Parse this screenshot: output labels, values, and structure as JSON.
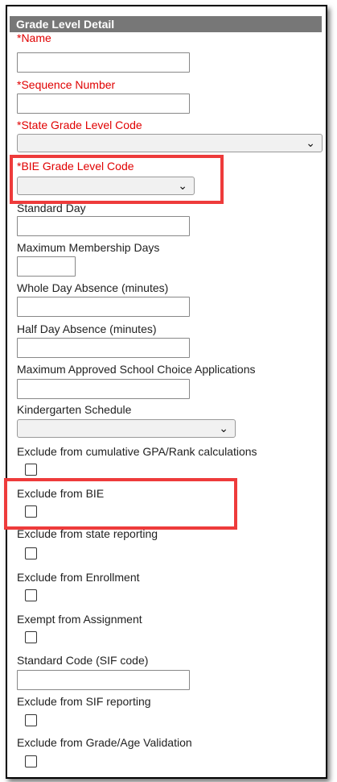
{
  "header": {
    "title": "Grade Level Detail"
  },
  "fields": {
    "name": {
      "label": "*Name",
      "value": ""
    },
    "sequence_number": {
      "label": "*Sequence Number",
      "value": ""
    },
    "state_grade_level_code": {
      "label": "*State Grade Level Code",
      "value": ""
    },
    "bie_grade_level_code": {
      "label": "*BIE Grade Level Code",
      "value": ""
    },
    "standard_day": {
      "label": "Standard Day",
      "value": ""
    },
    "maximum_membership_days": {
      "label": "Maximum Membership Days",
      "value": ""
    },
    "whole_day_absence": {
      "label": "Whole Day Absence (minutes)",
      "value": ""
    },
    "half_day_absence": {
      "label": "Half Day Absence (minutes)",
      "value": ""
    },
    "max_school_choice_apps": {
      "label": "Maximum Approved School Choice Applications",
      "value": ""
    },
    "kindergarten_schedule": {
      "label": "Kindergarten Schedule",
      "value": ""
    },
    "exclude_gpa_rank": {
      "label": "Exclude from cumulative GPA/Rank calculations",
      "checked": false
    },
    "exclude_bie": {
      "label": "Exclude from BIE",
      "checked": false
    },
    "exclude_state_reporting": {
      "label": "Exclude from state reporting",
      "checked": false
    },
    "exclude_enrollment": {
      "label": "Exclude from Enrollment",
      "checked": false
    },
    "exempt_assignment": {
      "label": "Exempt from Assignment",
      "checked": false
    },
    "standard_code_sif": {
      "label": "Standard Code (SIF code)",
      "value": ""
    },
    "exclude_sif_reporting": {
      "label": "Exclude from SIF reporting",
      "checked": false
    },
    "exclude_grade_age_validation": {
      "label": "Exclude from Grade/Age Validation",
      "checked": false
    }
  },
  "icons": {
    "dropdown": "chevron-down-icon"
  },
  "colors": {
    "required": "#e00000",
    "highlight": "#ee3b3b",
    "header_bg": "#777777"
  }
}
